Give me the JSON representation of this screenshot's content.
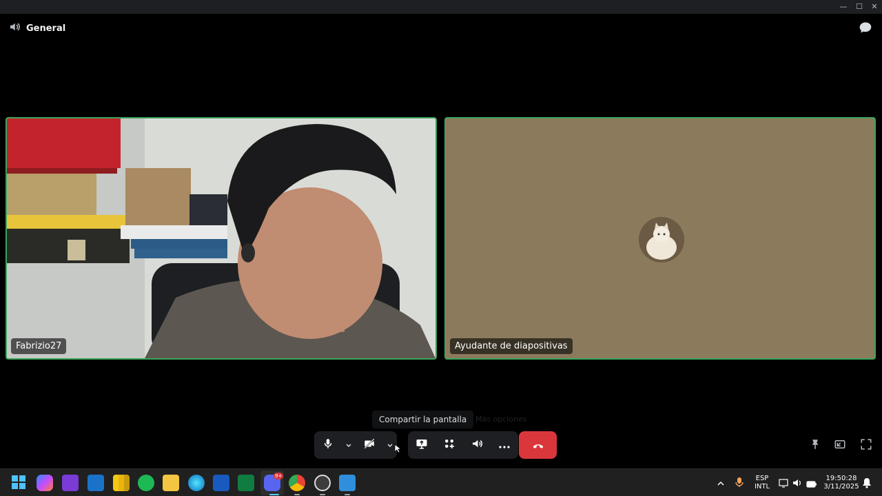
{
  "window": {
    "minimize": "—",
    "maximize": "☐",
    "close": "✕"
  },
  "channel": {
    "name": "General",
    "icon": "speaker-icon"
  },
  "participants": [
    {
      "name": "Fabrizio27",
      "video": true
    },
    {
      "name": "Ayudante de diapositivas",
      "video": false,
      "avatar": "cat-avatar"
    }
  ],
  "tooltip": {
    "label": "Compartir la pantalla",
    "ghost_label": "Más opciones"
  },
  "controls": {
    "mic": "microphone-icon",
    "camera": "camera-off-icon",
    "share": "screen-share-icon",
    "activities": "activities-icon",
    "soundboard": "soundboard-icon",
    "more": "more-icon",
    "hangup": "hang-up-icon"
  },
  "colors": {
    "speaking_border": "#3ba55c",
    "hangup": "#da373c",
    "avatar_tile": "#8c7a5c"
  },
  "tray": {
    "language_top": "ESP",
    "language_bottom": "INTL",
    "time": "19:50:28",
    "date": "3/11/2025",
    "discord_badge": "9+"
  }
}
